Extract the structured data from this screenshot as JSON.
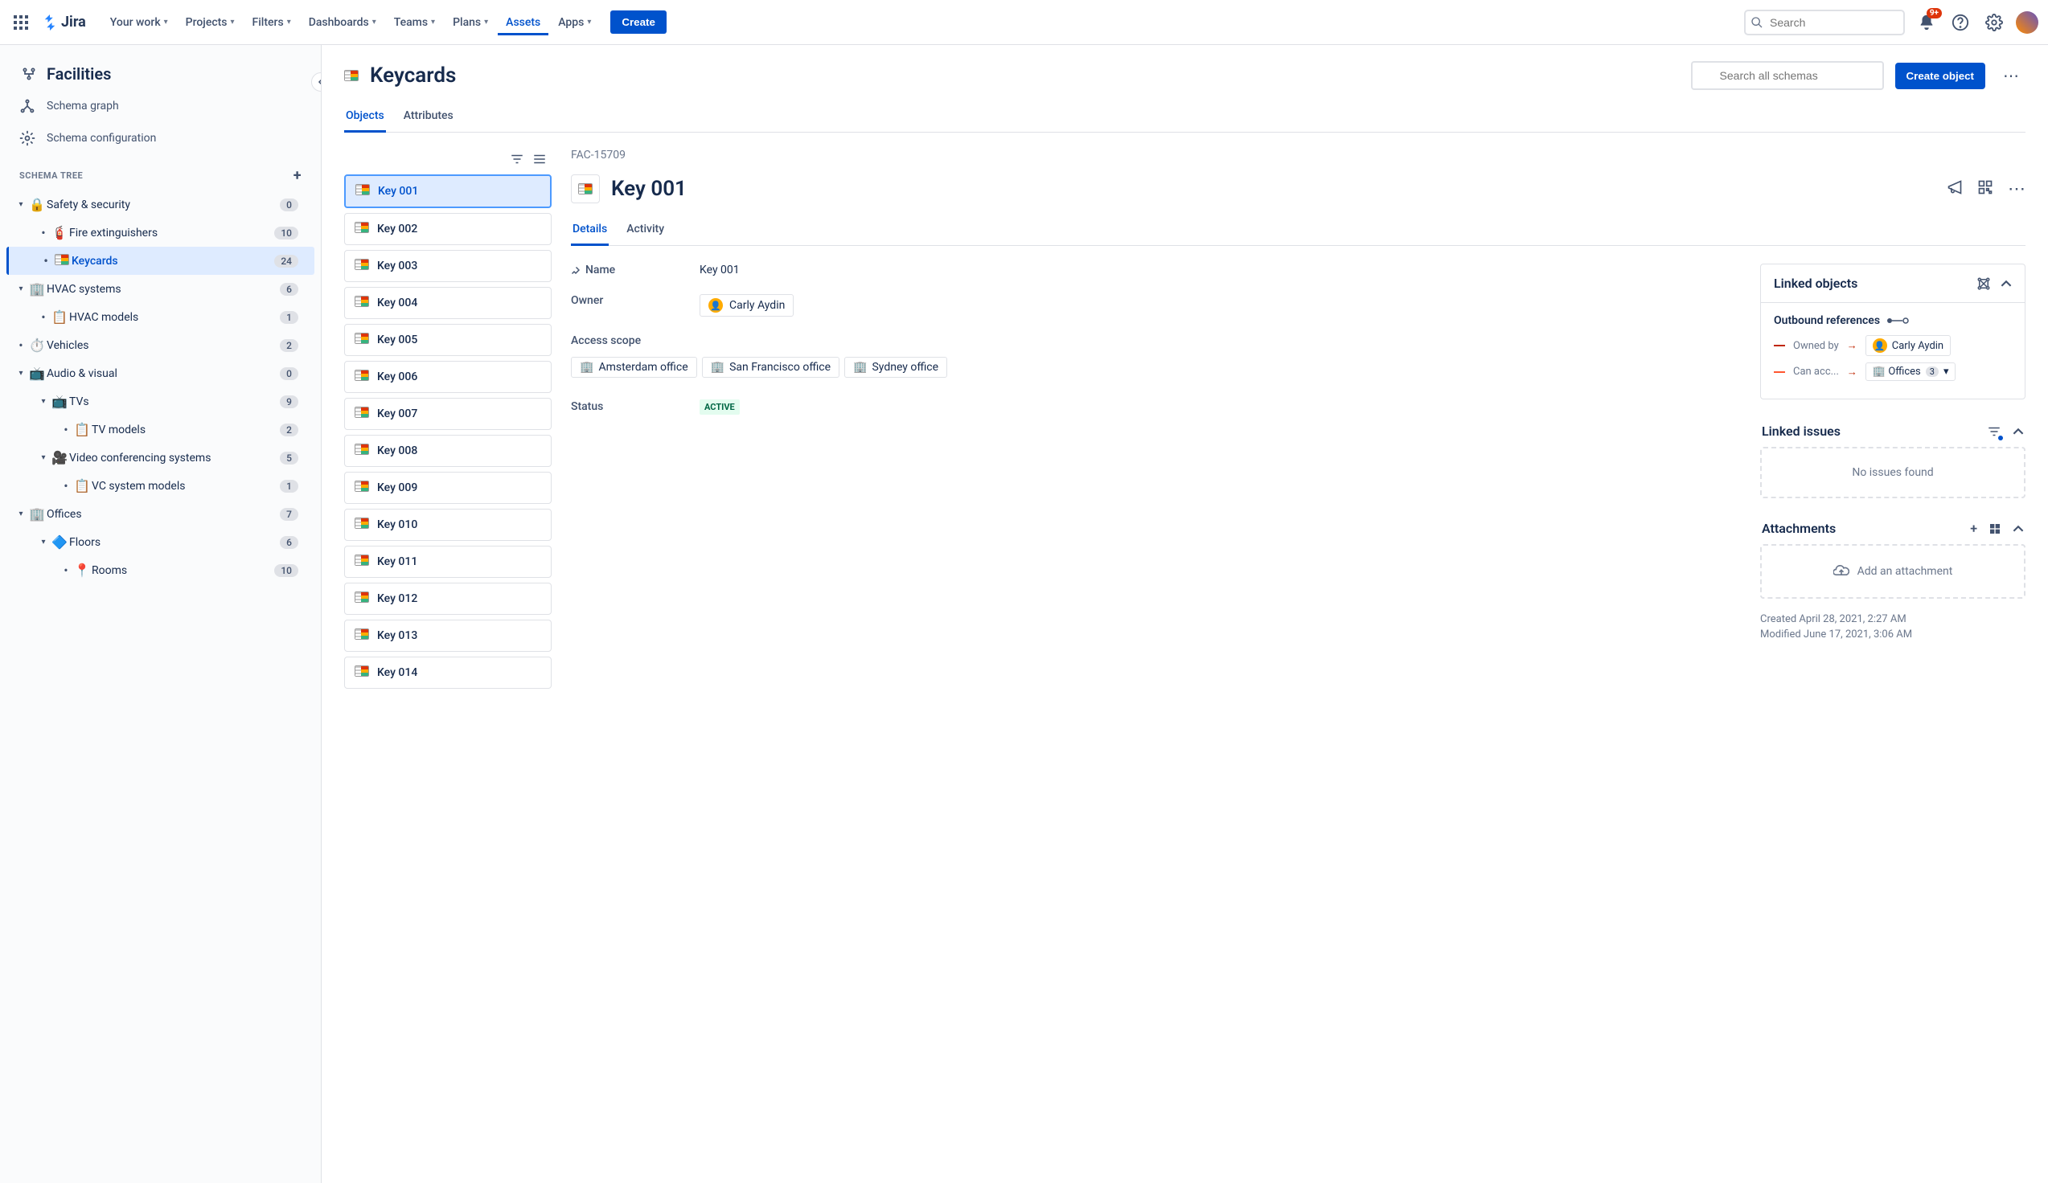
{
  "topnav": {
    "logo_text": "Jira",
    "items": [
      "Your work",
      "Projects",
      "Filters",
      "Dashboards",
      "Teams",
      "Plans",
      "Assets",
      "Apps"
    ],
    "active_index": 6,
    "create_label": "Create",
    "search_placeholder": "Search",
    "notification_badge": "9+"
  },
  "sidebar": {
    "schema_name": "Facilities",
    "links": [
      {
        "label": "Schema graph"
      },
      {
        "label": "Schema configuration"
      }
    ],
    "tree_header": "SCHEMA TREE",
    "tree": [
      {
        "depth": 0,
        "expandable": true,
        "expanded": true,
        "icon": "🔒",
        "label": "Safety & security",
        "count": "0"
      },
      {
        "depth": 1,
        "expandable": false,
        "icon": "🧯",
        "label": "Fire extinguishers",
        "count": "10"
      },
      {
        "depth": 1,
        "expandable": false,
        "icon": "keycard",
        "label": "Keycards",
        "count": "24",
        "selected": true
      },
      {
        "depth": 0,
        "expandable": true,
        "expanded": true,
        "icon": "🏢",
        "label": "HVAC systems",
        "count": "6"
      },
      {
        "depth": 1,
        "expandable": false,
        "icon": "📋",
        "label": "HVAC models",
        "count": "1"
      },
      {
        "depth": 0,
        "expandable": false,
        "icon": "⏱️",
        "label": "Vehicles",
        "count": "2"
      },
      {
        "depth": 0,
        "expandable": true,
        "expanded": true,
        "icon": "📺",
        "label": "Audio & visual",
        "count": "0"
      },
      {
        "depth": 1,
        "expandable": true,
        "expanded": true,
        "icon": "📺",
        "label": "TVs",
        "count": "9"
      },
      {
        "depth": 2,
        "expandable": false,
        "icon": "📋",
        "label": "TV models",
        "count": "2"
      },
      {
        "depth": 1,
        "expandable": true,
        "expanded": true,
        "icon": "🎥",
        "label": "Video conferencing systems",
        "count": "5"
      },
      {
        "depth": 2,
        "expandable": false,
        "icon": "📋",
        "label": "VC system models",
        "count": "1"
      },
      {
        "depth": 0,
        "expandable": true,
        "expanded": true,
        "icon": "🏢",
        "label": "Offices",
        "count": "7"
      },
      {
        "depth": 1,
        "expandable": true,
        "expanded": true,
        "icon": "🔷",
        "label": "Floors",
        "count": "6"
      },
      {
        "depth": 2,
        "expandable": false,
        "icon": "📍",
        "label": "Rooms",
        "count": "10"
      }
    ]
  },
  "page": {
    "title": "Keycards",
    "search_placeholder": "Search all schemas",
    "create_object_label": "Create object",
    "tabs": [
      "Objects",
      "Attributes"
    ],
    "active_tab": 0
  },
  "object_list": [
    "Key 001",
    "Key 002",
    "Key 003",
    "Key 004",
    "Key 005",
    "Key 006",
    "Key 007",
    "Key 008",
    "Key 009",
    "Key 010",
    "Key 011",
    "Key 012",
    "Key 013",
    "Key 014"
  ],
  "object_selected": 0,
  "detail": {
    "id": "FAC-15709",
    "title": "Key 001",
    "tabs": [
      "Details",
      "Activity"
    ],
    "active_tab": 0,
    "fields": {
      "name_label": "Name",
      "name_value": "Key 001",
      "owner_label": "Owner",
      "owner_value": "Carly Aydin",
      "access_scope_label": "Access scope",
      "access_scope_values": [
        "Amsterdam office",
        "San Francisco office",
        "Sydney office"
      ],
      "status_label": "Status",
      "status_value": "ACTIVE"
    },
    "linked_objects": {
      "title": "Linked objects",
      "outbound_label": "Outbound references",
      "rows": [
        {
          "relation": "Owned by",
          "target": "Carly Aydin",
          "type": "person"
        },
        {
          "relation": "Can acc...",
          "target": "Offices",
          "type": "object",
          "count": "3"
        }
      ]
    },
    "linked_issues": {
      "title": "Linked issues",
      "empty_text": "No issues found"
    },
    "attachments": {
      "title": "Attachments",
      "empty_text": "Add an attachment"
    },
    "meta": {
      "created": "Created April 28, 2021, 2:27 AM",
      "modified": "Modified June 17, 2021, 3:06 AM"
    }
  }
}
